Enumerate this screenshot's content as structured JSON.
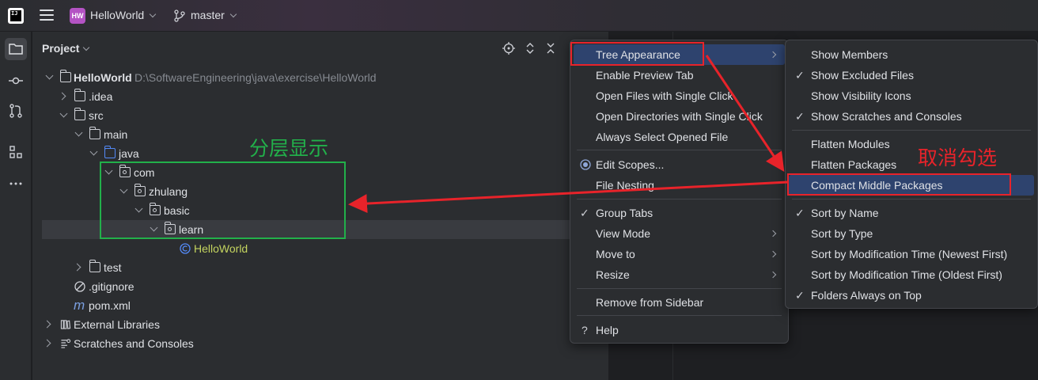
{
  "titlebar": {
    "logo_text": "IJ",
    "project_badge": "HW",
    "project_name": "HelloWorld",
    "branch": "master"
  },
  "toolstrip": {
    "icons": [
      "folder-icon",
      "commit-icon",
      "pull-request-icon",
      "structure-icon",
      "more-icon"
    ]
  },
  "project_panel": {
    "title": "Project",
    "tree": [
      {
        "label": "HelloWorld",
        "path": "D:\\SoftwareEngineering\\java\\exercise\\HelloWorld",
        "expanded": true,
        "icon": "module-folder-icon"
      },
      {
        "label": ".idea",
        "expanded": false,
        "icon": "folder-icon"
      },
      {
        "label": "src",
        "expanded": true,
        "icon": "folder-icon"
      },
      {
        "label": "main",
        "expanded": true,
        "icon": "folder-icon"
      },
      {
        "label": "java",
        "expanded": true,
        "icon": "source-folder-icon"
      },
      {
        "label": "com",
        "expanded": true,
        "icon": "package-icon"
      },
      {
        "label": "zhulang",
        "expanded": true,
        "icon": "package-icon"
      },
      {
        "label": "basic",
        "expanded": true,
        "icon": "package-icon"
      },
      {
        "label": "learn",
        "expanded": true,
        "icon": "package-icon",
        "selected": true
      },
      {
        "label": "HelloWorld",
        "icon": "class-icon"
      },
      {
        "label": "test",
        "expanded": false,
        "icon": "folder-icon"
      },
      {
        "label": ".gitignore",
        "icon": "ignore-file-icon"
      },
      {
        "label": "pom.xml",
        "icon": "maven-icon"
      },
      {
        "label": "External Libraries",
        "expanded": false,
        "icon": "library-icon"
      },
      {
        "label": "Scratches and Consoles",
        "expanded": false,
        "icon": "scratches-icon"
      }
    ]
  },
  "context_menu": {
    "items": [
      {
        "label": "Tree Appearance",
        "submenu": true,
        "highlighted": true
      },
      {
        "label": "Enable Preview Tab"
      },
      {
        "label": "Open Files with Single Click"
      },
      {
        "label": "Open Directories with Single Click"
      },
      {
        "label": "Always Select Opened File"
      },
      {
        "label": "Edit Scopes...",
        "icon": "scope-icon"
      },
      {
        "label": "File Nesting..."
      },
      {
        "label": "Group Tabs",
        "checked": true
      },
      {
        "label": "View Mode",
        "submenu": true
      },
      {
        "label": "Move to",
        "submenu": true
      },
      {
        "label": "Resize",
        "submenu": true
      },
      {
        "label": "Remove from Sidebar"
      },
      {
        "label": "Help",
        "icon": "help-icon"
      }
    ]
  },
  "submenu": {
    "items": [
      {
        "label": "Show Members"
      },
      {
        "label": "Show Excluded Files",
        "checked": true
      },
      {
        "label": "Show Visibility Icons"
      },
      {
        "label": "Show Scratches and Consoles",
        "checked": true
      },
      {
        "label": "Flatten Modules"
      },
      {
        "label": "Flatten Packages"
      },
      {
        "label": "Compact Middle Packages",
        "highlighted": true
      },
      {
        "label": "Sort by Name",
        "checked": true
      },
      {
        "label": "Sort by Type"
      },
      {
        "label": "Sort by Modification Time (Newest First)"
      },
      {
        "label": "Sort by Modification Time (Oldest First)"
      },
      {
        "label": "Folders Always on Top",
        "checked": true
      }
    ]
  },
  "annotations": {
    "hierarchy_label": "分层显示",
    "uncheck_label": "取消勾选",
    "green": "#22b04a",
    "red": "#e8232a"
  },
  "colors": {
    "accent_selection": "#2e436e",
    "class_name": "#c4d45f",
    "source_folder": "#548af7"
  }
}
